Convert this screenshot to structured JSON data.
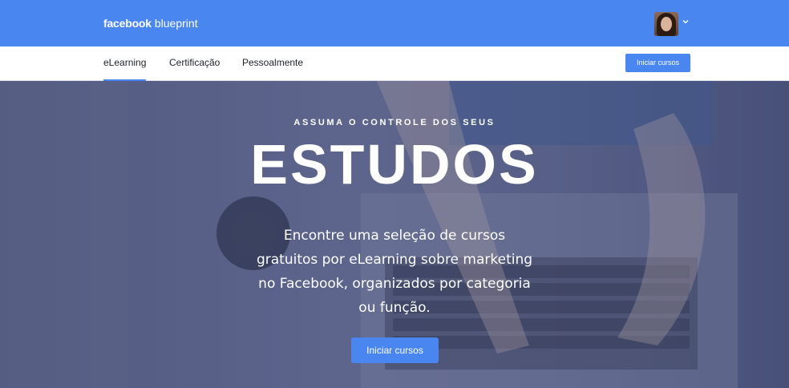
{
  "header": {
    "brand_bold": "facebook",
    "brand_light": "blueprint",
    "avatar_icon": "user-avatar",
    "menu_icon": "chevron-down-icon",
    "background_color": "#4a86f0"
  },
  "nav": {
    "items": [
      {
        "label": "eLearning",
        "active": true
      },
      {
        "label": "Certificação",
        "active": false
      },
      {
        "label": "Pessoalmente",
        "active": false
      }
    ],
    "cta_label": "Iniciar cursos"
  },
  "hero": {
    "kicker": "ASSUMA O CONTROLE DOS SEUS",
    "headline": "ESTUDOS",
    "description_lines": [
      "Encontre uma seleção de cursos",
      "gratuitos por eLearning sobre marketing",
      "no Facebook, organizados por categoria",
      "ou função."
    ],
    "cta_label": "Iniciar cursos",
    "background_image": "hands-typing-on-laptop-photo"
  },
  "colors": {
    "accent": "#4a86f0",
    "hero_overlay": "#3e4a7a"
  }
}
